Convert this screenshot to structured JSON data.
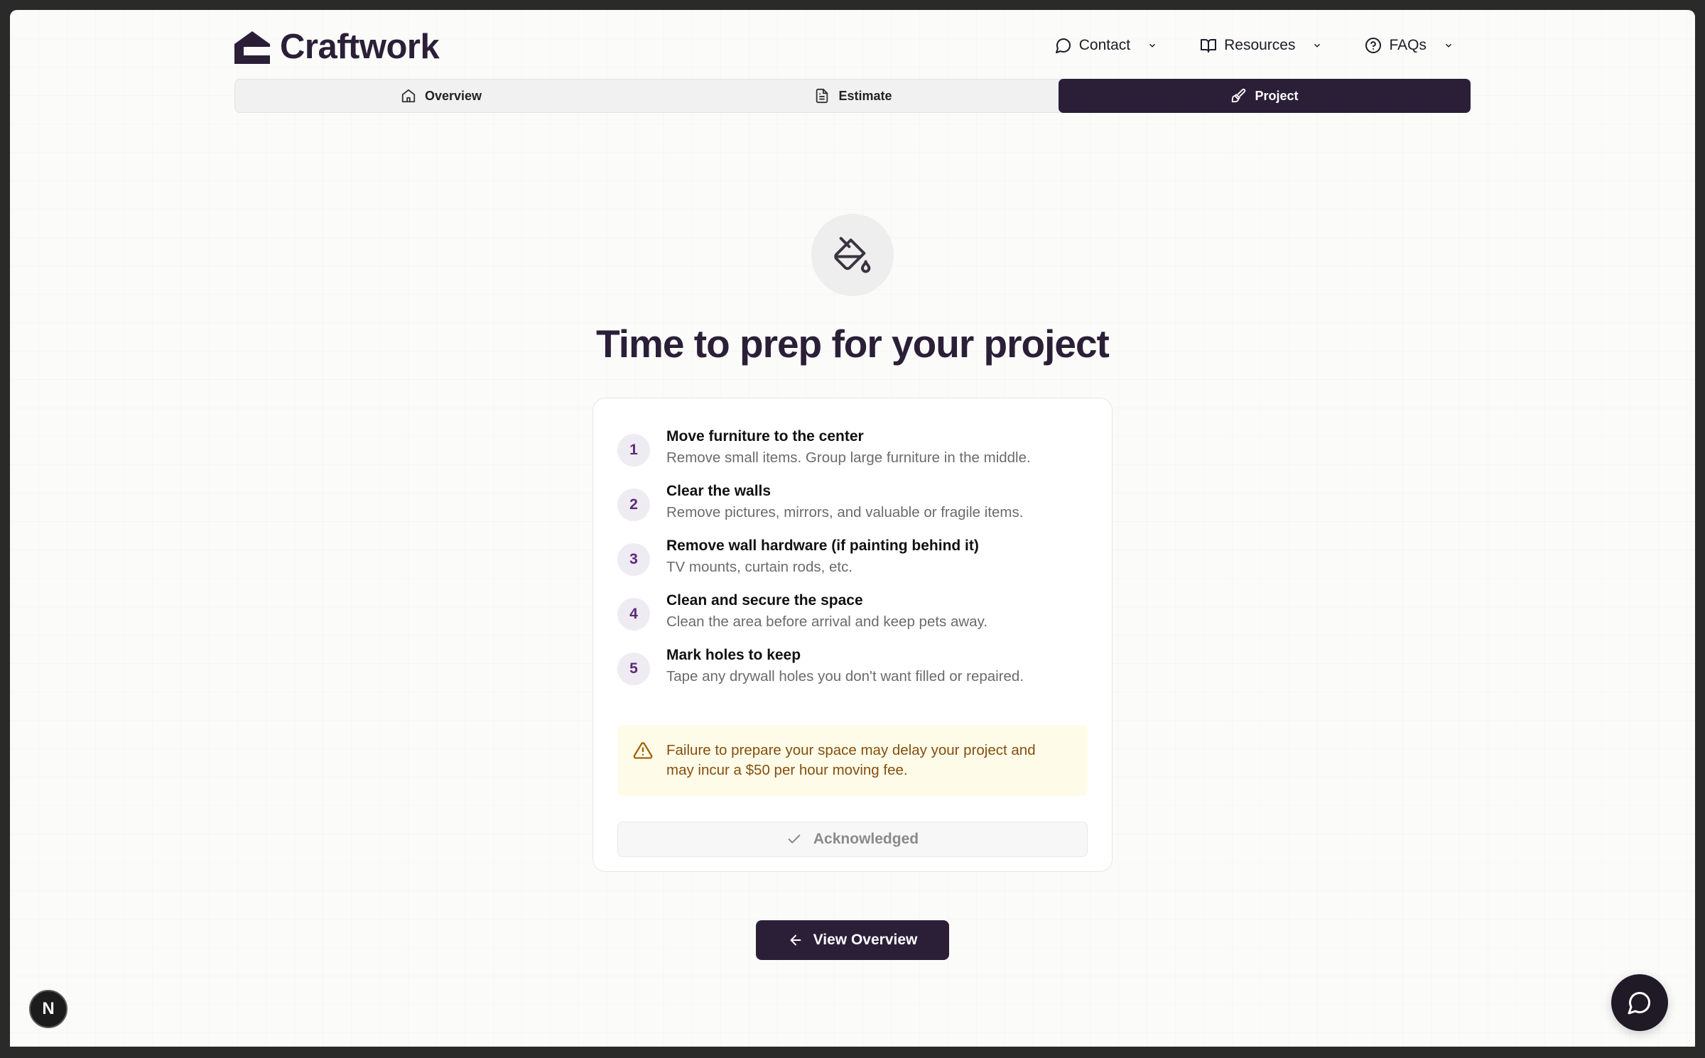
{
  "brand": {
    "name": "Craftwork"
  },
  "topnav": {
    "contact": "Contact",
    "resources": "Resources",
    "faqs": "FAQs"
  },
  "tabs": [
    {
      "label": "Overview",
      "icon": "home-icon"
    },
    {
      "label": "Estimate",
      "icon": "document-icon"
    },
    {
      "label": "Project",
      "icon": "paintbrush-icon",
      "active": true
    }
  ],
  "hero": {
    "icon": "paint-bucket-icon",
    "title": "Time to prep for your project"
  },
  "steps": [
    {
      "number": "1",
      "title": "Move furniture to the center",
      "description": "Remove small items. Group large furniture in the middle."
    },
    {
      "number": "2",
      "title": "Clear the walls",
      "description": "Remove pictures, mirrors, and valuable or fragile items."
    },
    {
      "number": "3",
      "title": "Remove wall hardware (if painting behind it)",
      "description": "TV mounts, curtain rods, etc."
    },
    {
      "number": "4",
      "title": "Clean and secure the space",
      "description": "Clean the area before arrival and keep pets away."
    },
    {
      "number": "5",
      "title": "Mark holes to keep",
      "description": "Tape any drywall holes you don't want filled or repaired."
    }
  ],
  "warning": {
    "text": "Failure to prepare your space may delay your project and may incur a $50 per hour moving fee."
  },
  "acknowledge": {
    "label": "Acknowledged"
  },
  "cta": {
    "label": "View Overview"
  },
  "dev_badge": {
    "label": "N"
  },
  "colors": {
    "brand": "#2b1f38",
    "accent": "#5a2a7a",
    "warning_bg": "#fefce8",
    "warning_text": "#854d0e"
  }
}
